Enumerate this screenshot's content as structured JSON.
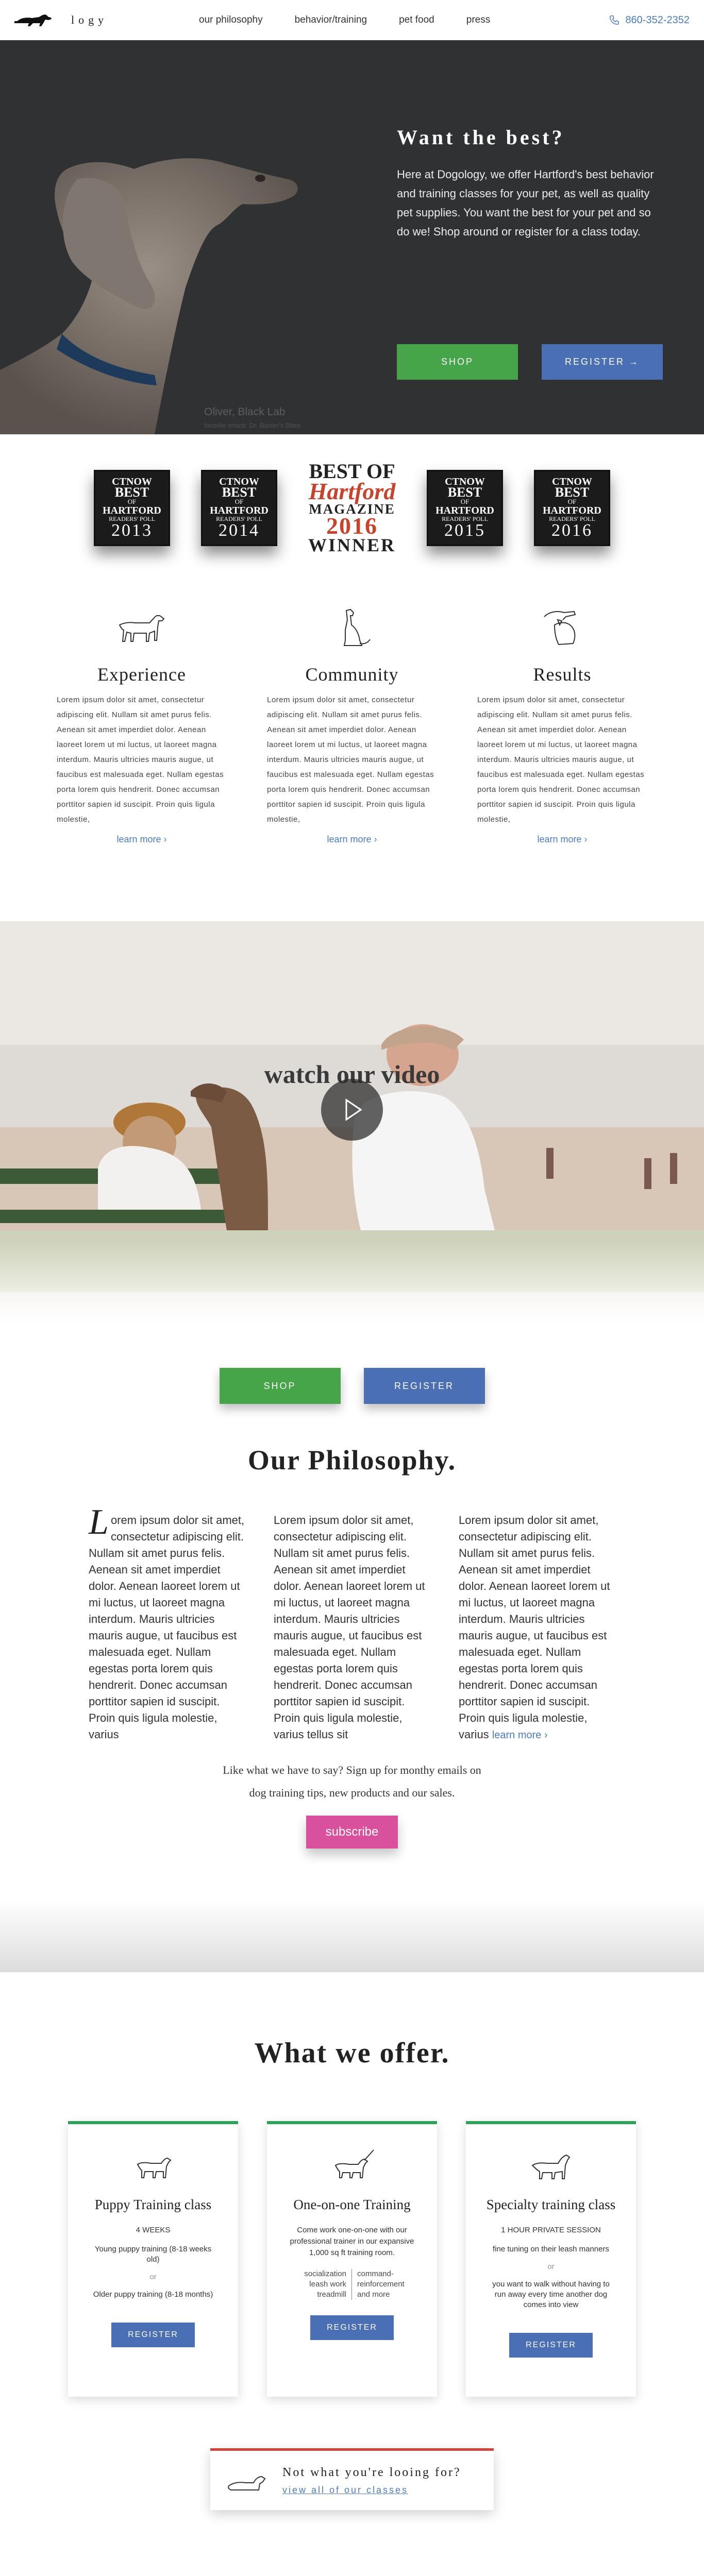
{
  "nav": {
    "logo_text": "logy",
    "links": [
      "our philosophy",
      "behavior/training",
      "pet food",
      "press"
    ],
    "phone": "860-352-2352"
  },
  "hero": {
    "title": "Want the best?",
    "text": "Here at Dogology, we offer Hartford's best behavior and training classes for your pet, as well as quality pet supplies. You want the best for your pet and so do we! Shop around or register for a class today.",
    "caption_name": "Oliver, Black Lab",
    "caption_sub": "favorite snack: Dr. Baxter's Bites",
    "shop_label": "SHOP",
    "register_label": "REGISTER →"
  },
  "awards": [
    {
      "top": "CTNOW",
      "mid": "BEST",
      "of": "OF",
      "city": "HARTFORD",
      "poll": "READERS' POLL",
      "year": "2013"
    },
    {
      "top": "CTNOW",
      "mid": "BEST",
      "of": "OF",
      "city": "HARTFORD",
      "poll": "READERS' POLL",
      "year": "2014"
    },
    {
      "top": "CTNOW",
      "mid": "BEST",
      "of": "OF",
      "city": "HARTFORD",
      "poll": "READERS' POLL",
      "year": "2015"
    },
    {
      "top": "CTNOW",
      "mid": "BEST",
      "of": "OF",
      "city": "HARTFORD",
      "poll": "READERS' POLL",
      "year": "2016"
    }
  ],
  "award_big": {
    "l1": "BEST OF",
    "l2": "Hartford",
    "l3": "MAGAZINE",
    "l4": "2016",
    "l5": "WINNER"
  },
  "features": [
    {
      "title": "Experience",
      "text": "Lorem ipsum dolor sit amet, consectetur adipiscing elit. Nullam sit amet purus felis. Aenean sit amet imperdiet dolor. Aenean laoreet lorem ut mi luctus, ut laoreet magna interdum. Mauris ultricies mauris augue, ut faucibus est malesuada eget. Nullam egestas porta lorem quis hendrerit. Donec accumsan porttitor sapien id suscipit. Proin quis ligula molestie,",
      "more": "learn more ›"
    },
    {
      "title": "Community",
      "text": "Lorem ipsum dolor sit amet, consectetur adipiscing elit. Nullam sit amet purus felis. Aenean sit amet imperdiet dolor. Aenean laoreet lorem ut mi luctus, ut laoreet magna interdum. Mauris ultricies mauris augue, ut faucibus est malesuada eget. Nullam egestas porta lorem quis hendrerit. Donec accumsan porttitor sapien id suscipit. Proin quis ligula molestie,",
      "more": "learn more ›"
    },
    {
      "title": "Results",
      "text": "Lorem ipsum dolor sit amet, consectetur adipiscing elit. Nullam sit amet purus felis. Aenean sit amet imperdiet dolor. Aenean laoreet lorem ut mi luctus, ut laoreet magna interdum. Mauris ultricies mauris augue, ut faucibus est malesuada eget. Nullam egestas porta lorem quis hendrerit. Donec accumsan porttitor sapien id suscipit. Proin quis ligula molestie,",
      "more": "learn more ›"
    }
  ],
  "video": {
    "title": "watch our video"
  },
  "cta": {
    "shop_label": "SHOP",
    "register_label": "REGISTER"
  },
  "philosophy": {
    "title": "Our Philosophy.",
    "drop": "L",
    "col1": "orem ipsum dolor sit amet, consectetur adipiscing elit. Nullam sit amet purus felis. Aenean sit amet imperdiet dolor. Aenean laoreet lorem ut mi luctus, ut laoreet magna interdum. Mauris ultricies mauris augue, ut faucibus est malesuada eget. Nullam egestas porta lorem quis hendrerit. Donec accumsan porttitor sapien id suscipit. Proin quis ligula molestie, varius",
    "col2": "Lorem ipsum dolor sit amet, consectetur adipiscing elit. Nullam sit amet purus felis. Aenean sit amet imperdiet dolor. Aenean laoreet lorem ut mi luctus, ut laoreet magna interdum. Mauris ultricies mauris augue, ut faucibus est malesuada eget. Nullam egestas porta lorem quis hendrerit. Donec accumsan porttitor sapien id suscipit. Proin quis ligula molestie, varius tellus sit",
    "col3": "Lorem ipsum dolor sit amet, consectetur adipiscing elit. Nullam sit amet purus felis. Aenean sit amet imperdiet dolor. Aenean laoreet lorem ut mi luctus, ut laoreet magna interdum. Mauris ultricies mauris augue, ut faucibus est malesuada eget. Nullam egestas porta lorem quis hendrerit. Donec accumsan porttitor sapien id suscipit. Proin quis ligula molestie, varius",
    "more": "learn more ›",
    "newsletter_1": "Like what we have to say? Sign up for monthy emails on",
    "newsletter_2": "dog training tips, new products and our sales.",
    "subscribe_label": "subscribe"
  },
  "offer": {
    "title": "What we offer.",
    "cards": [
      {
        "title": "Puppy Training class",
        "lead": "4 WEEKS",
        "l1": "Young puppy training (8-18 weeks old)",
        "or": "or",
        "l2": "Older puppy training (8-18 months)",
        "btn": "REGISTER"
      },
      {
        "title": "One-on-one Training",
        "lead": "Come work one-on-one with our professional trainer in our expansive 1,000 sq ft training room.",
        "c1": "socialization leash work treadmill",
        "c2": "command-reinforcement and more",
        "btn": "REGISTER"
      },
      {
        "title": "Specialty training class",
        "lead": "1 HOUR PRIVATE SESSION",
        "l1": "fine tuning on their leash manners",
        "or": "or",
        "l2": "you want to walk without having to run away every time another dog comes into view",
        "btn": "REGISTER"
      }
    ],
    "looking_title": "Not what you're looing for?",
    "looking_link": "view all of our classes"
  }
}
